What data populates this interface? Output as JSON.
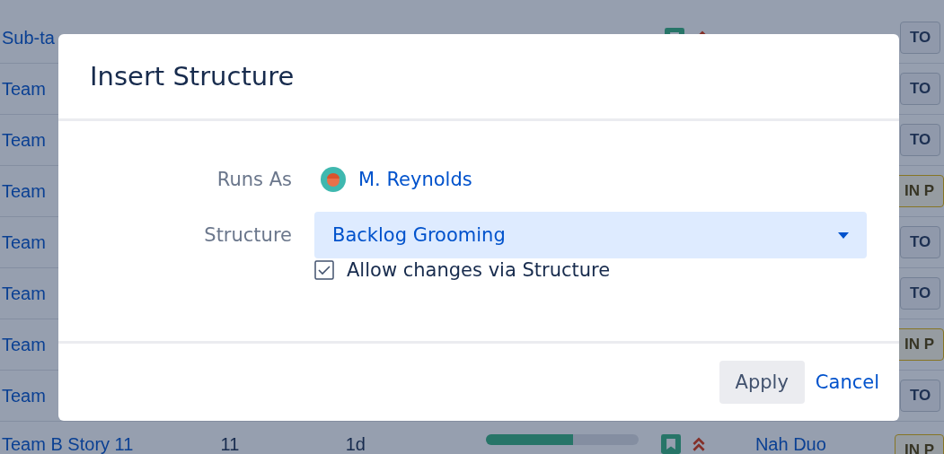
{
  "table": {
    "rows": [
      {
        "summary": "Sub-ta",
        "kind": "full",
        "status": {
          "label": "TO",
          "kind": "todo"
        }
      },
      {
        "summary": "Team",
        "status": {
          "label": "TO",
          "kind": "todo"
        }
      },
      {
        "summary": "Team",
        "status": {
          "label": "TO",
          "kind": "todo"
        }
      },
      {
        "summary": "Team",
        "status": {
          "label": "IN P",
          "kind": "inprogress"
        }
      },
      {
        "summary": "Team",
        "status": {
          "label": "TO",
          "kind": "todo"
        }
      },
      {
        "summary": "Team",
        "status": {
          "label": "TO",
          "kind": "todo"
        }
      },
      {
        "summary": "Team",
        "status": {
          "label": "IN P",
          "kind": "inprogress"
        }
      },
      {
        "summary": "Team",
        "status": {
          "label": "TO",
          "kind": "todo"
        }
      },
      {
        "summary": "Team B Story 11",
        "kind": "full",
        "points": "11",
        "estimate": "1d",
        "progress": {
          "level": 0.57
        },
        "assignee": "Nah Duo",
        "status": {
          "label": "IN P",
          "kind": "inprogress"
        }
      }
    ]
  },
  "dialog": {
    "title": "Insert Structure",
    "runs_as": {
      "label": "Runs As",
      "user": "M. Reynolds"
    },
    "structure": {
      "label": "Structure",
      "value": "Backlog Grooming"
    },
    "allow_changes": {
      "label": "Allow changes via Structure",
      "checked": true
    },
    "buttons": {
      "apply": "Apply",
      "cancel": "Cancel"
    }
  }
}
